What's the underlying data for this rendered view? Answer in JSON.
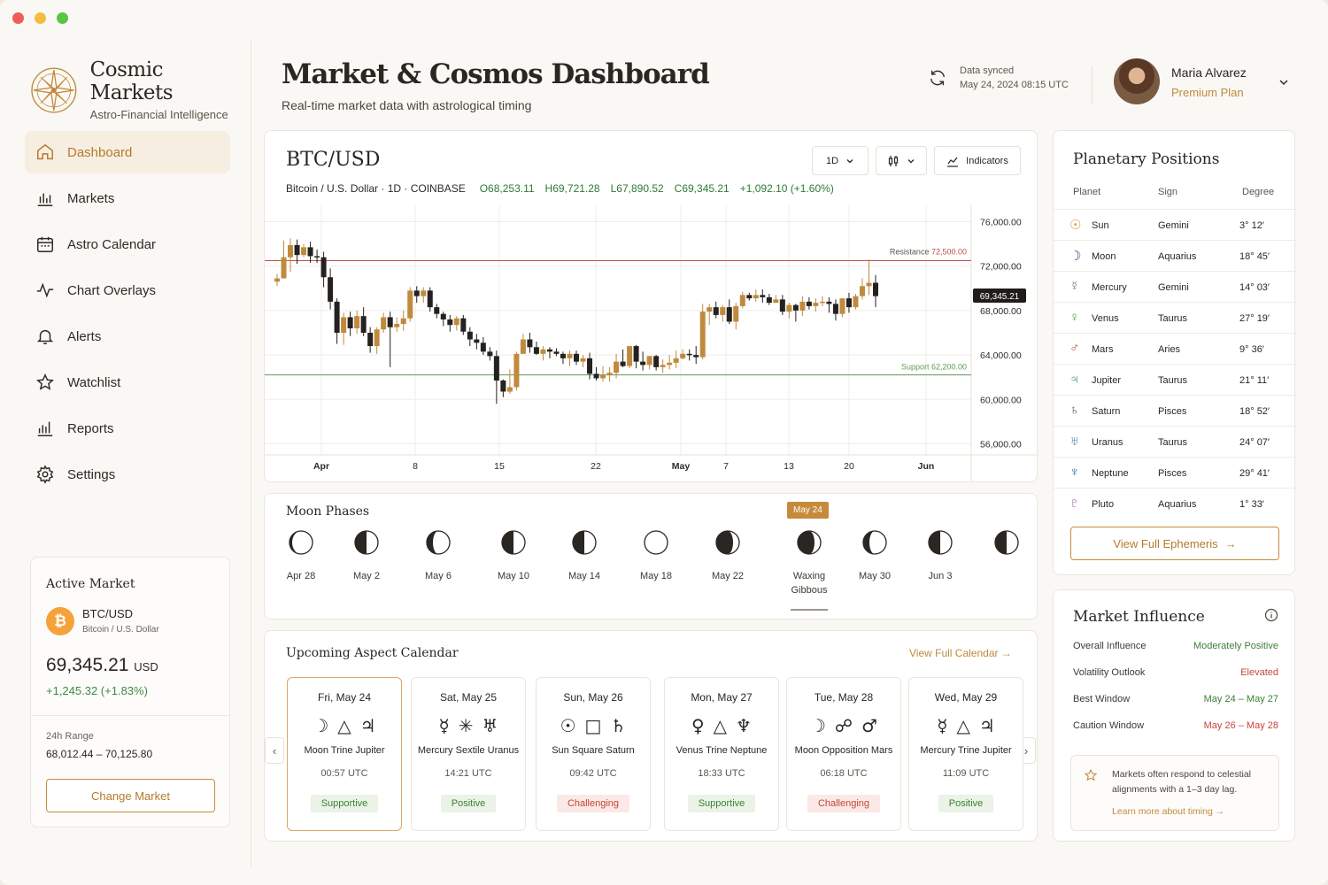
{
  "brand": {
    "title": "Cosmic Markets",
    "subtitle": "Astro-Financial Intelligence"
  },
  "nav": [
    {
      "label": "Dashboard",
      "icon": "home-icon",
      "active": true
    },
    {
      "label": "Markets",
      "icon": "bar-chart-icon"
    },
    {
      "label": "Astro Calendar",
      "icon": "calendar-icon"
    },
    {
      "label": "Chart Overlays",
      "icon": "activity-icon"
    },
    {
      "label": "Alerts",
      "icon": "bell-icon"
    },
    {
      "label": "Watchlist",
      "icon": "star-icon"
    },
    {
      "label": "Reports",
      "icon": "reports-icon"
    },
    {
      "label": "Settings",
      "icon": "gear-icon"
    }
  ],
  "active_market": {
    "title": "Active Market",
    "coin_symbol": "₿",
    "pair": "BTC/USD",
    "pair_name": "Bitcoin / U.S. Dollar",
    "price": "69,345.21",
    "currency": "USD",
    "change": "+1,245.32 (+1.83%)",
    "range_label": "24h Range",
    "range_value": "68,012.44 – 70,125.80",
    "button": "Change Market"
  },
  "header": {
    "title": "Market & Cosmos Dashboard",
    "subtitle": "Real-time market data with astrological timing",
    "sync_label": "Data synced",
    "sync_time": "May 24, 2024  08:15 UTC",
    "user_name": "Maria Alvarez",
    "user_plan": "Premium Plan"
  },
  "chart_panel": {
    "title": "BTC/USD",
    "subtitle": "Bitcoin / U.S. Dollar · 1D · COINBASE",
    "open": "O68,253.11",
    "high": "H69,721.28",
    "low": "L67,890.52",
    "close": "C69,345.21",
    "change": "+1,092.10 (+1.60%)",
    "interval": "1D",
    "indicators_label": "Indicators"
  },
  "chart_data": {
    "type": "candlestick",
    "y_ticks": [
      "76,000.00",
      "72,000.00",
      "68,000.00",
      "64,000.00",
      "60,000.00",
      "56,000.00"
    ],
    "ylim": [
      55000,
      77000
    ],
    "x_ticks": [
      "Apr",
      "8",
      "15",
      "22",
      "May",
      "7",
      "13",
      "20",
      "Jun"
    ],
    "current_price": "69,345.21",
    "resistance": {
      "label": "Resistance",
      "value": "72,500.00",
      "level": 72500
    },
    "support": {
      "label": "Support",
      "value": "62,200.00",
      "level": 62200
    },
    "candles": [
      [
        70600,
        70900,
        70200,
        71300
      ],
      [
        70900,
        72800,
        72500,
        74300
      ],
      [
        72800,
        73900,
        71500,
        74500
      ],
      [
        73900,
        73000,
        72200,
        74400
      ],
      [
        73000,
        73700,
        72800,
        74000
      ],
      [
        73700,
        72900,
        72300,
        74200
      ],
      [
        72900,
        72800,
        72300,
        73500
      ],
      [
        72800,
        71000,
        70100,
        73300
      ],
      [
        71000,
        68800,
        68100,
        71800
      ],
      [
        68800,
        66000,
        65000,
        69100
      ],
      [
        66000,
        67400,
        64900,
        67800
      ],
      [
        67400,
        66400,
        65700,
        67900
      ],
      [
        66400,
        67500,
        65900,
        68000
      ],
      [
        67500,
        66000,
        65700,
        68300
      ],
      [
        66000,
        64800,
        64200,
        66500
      ],
      [
        64800,
        66300,
        64100,
        66500
      ],
      [
        66300,
        67400,
        66000,
        67800
      ],
      [
        67400,
        66500,
        62900,
        67900
      ],
      [
        66500,
        66800,
        66100,
        67400
      ],
      [
        66800,
        67300,
        66200,
        68000
      ],
      [
        67300,
        69800,
        67000,
        70100
      ],
      [
        69800,
        69300,
        68700,
        70200
      ],
      [
        69300,
        69800,
        68700,
        70100
      ],
      [
        69800,
        68300,
        67900,
        70100
      ],
      [
        68300,
        67700,
        67300,
        68600
      ],
      [
        67700,
        67200,
        66600,
        67900
      ],
      [
        67200,
        66700,
        66100,
        67600
      ],
      [
        66700,
        67300,
        66200,
        67500
      ],
      [
        67300,
        66100,
        65800,
        67600
      ],
      [
        66100,
        65400,
        64800,
        66500
      ],
      [
        65400,
        65100,
        64500,
        65900
      ],
      [
        65100,
        64300,
        64000,
        65600
      ],
      [
        64300,
        63900,
        63500,
        64700
      ],
      [
        63900,
        61700,
        59600,
        64400
      ],
      [
        61700,
        60700,
        60200,
        61800
      ],
      [
        60700,
        61100,
        60500,
        62700
      ],
      [
        61100,
        64100,
        60800,
        64300
      ],
      [
        64100,
        65400,
        64100,
        65900
      ],
      [
        65400,
        64700,
        64200,
        66000
      ],
      [
        64700,
        64100,
        64000,
        65200
      ],
      [
        64100,
        64500,
        63500,
        64800
      ],
      [
        64500,
        64300,
        63700,
        64700
      ],
      [
        64300,
        64100,
        63900,
        64600
      ],
      [
        64100,
        63700,
        63200,
        64300
      ],
      [
        63700,
        64100,
        63000,
        64400
      ],
      [
        64100,
        63400,
        63100,
        64400
      ],
      [
        63400,
        63700,
        62900,
        64000
      ],
      [
        63700,
        62300,
        61800,
        64200
      ],
      [
        62300,
        61900,
        61700,
        62900
      ],
      [
        61900,
        62200,
        61600,
        63000
      ],
      [
        62200,
        62400,
        61600,
        62900
      ],
      [
        62400,
        63400,
        61900,
        64100
      ],
      [
        63400,
        63000,
        62900,
        64500
      ],
      [
        63000,
        64800,
        62800,
        64800
      ],
      [
        64800,
        63400,
        62800,
        64900
      ],
      [
        63400,
        63100,
        62600,
        64300
      ],
      [
        63100,
        63900,
        62700,
        63900
      ],
      [
        63900,
        62900,
        62600,
        64000
      ],
      [
        62900,
        63100,
        62400,
        63600
      ],
      [
        63100,
        63300,
        62700,
        64000
      ],
      [
        63300,
        63700,
        62800,
        64400
      ],
      [
        63700,
        64100,
        63600,
        64500
      ],
      [
        64100,
        64000,
        63500,
        64500
      ],
      [
        64000,
        63800,
        63200,
        64800
      ],
      [
        63800,
        67900,
        63600,
        68600
      ],
      [
        67900,
        68300,
        66700,
        68600
      ],
      [
        68300,
        67600,
        67300,
        68800
      ],
      [
        67600,
        68300,
        67000,
        68500
      ],
      [
        68300,
        67000,
        66800,
        69000
      ],
      [
        67000,
        68400,
        66300,
        68700
      ],
      [
        68400,
        69400,
        68200,
        69700
      ],
      [
        69400,
        69100,
        68900,
        69600
      ],
      [
        69100,
        69400,
        68800,
        69900
      ],
      [
        69400,
        69200,
        68700,
        69900
      ],
      [
        69200,
        68700,
        68500,
        69500
      ],
      [
        68700,
        69000,
        68700,
        69400
      ],
      [
        69000,
        67900,
        67600,
        69400
      ],
      [
        67900,
        68500,
        67300,
        68700
      ],
      [
        68500,
        68000,
        67000,
        68600
      ],
      [
        68000,
        68800,
        67500,
        69300
      ],
      [
        68800,
        68400,
        68100,
        69200
      ],
      [
        68400,
        68700,
        67900,
        69100
      ],
      [
        68700,
        68800,
        68400,
        69300
      ],
      [
        68800,
        68600,
        67800,
        69200
      ],
      [
        68600,
        67700,
        67100,
        69000
      ],
      [
        67700,
        69100,
        67400,
        69100
      ],
      [
        69100,
        68300,
        67800,
        69600
      ],
      [
        68300,
        69300,
        68100,
        69500
      ],
      [
        69300,
        70200,
        69000,
        70900
      ],
      [
        70200,
        70500,
        69400,
        72600
      ],
      [
        70500,
        69300,
        68300,
        71200
      ]
    ],
    "colors": {
      "up": "#c08a3e",
      "down": "#24211e",
      "resistance": "#c0504a",
      "support": "#5e9a52"
    }
  },
  "moon_phases": {
    "title": "Moon Phases",
    "badge": "May 24",
    "items": [
      {
        "label": "Apr 28",
        "phase": "waning-crescent"
      },
      {
        "label": "May 2",
        "phase": "last-quarter"
      },
      {
        "label": "May 6",
        "phase": "waning-gibbous"
      },
      {
        "label": "May 10",
        "phase": "last-quarter"
      },
      {
        "label": "May 14",
        "phase": "first-quarter"
      },
      {
        "label": "May 18",
        "phase": "full"
      },
      {
        "label": "May 22",
        "phase": "waxing-gibbous"
      },
      {
        "label": "Waxing Gibbous",
        "phase": "waxing-gibbous",
        "current": true
      },
      {
        "label": "May 30",
        "phase": "waning-gibbous"
      },
      {
        "label": "Jun 3",
        "phase": "last-quarter"
      },
      {
        "label": "",
        "phase": "last-quarter"
      }
    ]
  },
  "aspects": {
    "title": "Upcoming Aspect Calendar",
    "link": "View Full Calendar →",
    "cards": [
      {
        "day": "Fri, May 24",
        "symbols": "☽△♃",
        "name": "Moon Trine Jupiter",
        "time": "00:57 UTC",
        "tag": "Supportive",
        "tone": "sup",
        "selected": true
      },
      {
        "day": "Sat, May 25",
        "symbols": "☿✳♅",
        "name": "Mercury Sextile Uranus",
        "time": "14:21 UTC",
        "tag": "Positive",
        "tone": "sup"
      },
      {
        "day": "Sun, May 26",
        "symbols": "☉□♄",
        "name": "Sun Square Saturn",
        "time": "09:42 UTC",
        "tag": "Challenging",
        "tone": "chal"
      },
      {
        "day": "Mon, May 27",
        "symbols": "♀△♆",
        "name": "Venus Trine Neptune",
        "time": "18:33 UTC",
        "tag": "Supportive",
        "tone": "sup"
      },
      {
        "day": "Tue, May 28",
        "symbols": "☽☍♂",
        "name": "Moon Opposition Mars",
        "time": "06:18 UTC",
        "tag": "Challenging",
        "tone": "chal"
      },
      {
        "day": "Wed, May 29",
        "symbols": "☿△♃",
        "name": "Mercury Trine Jupiter",
        "time": "11:09 UTC",
        "tag": "Positive",
        "tone": "sup"
      }
    ]
  },
  "planets": {
    "title": "Planetary Positions",
    "headers": [
      "Planet",
      "Sign",
      "Degree"
    ],
    "rows": [
      {
        "glyph": "☉",
        "planet": "Sun",
        "sign": "Gemini",
        "degree": "3° 12′",
        "color": "#d69a2d"
      },
      {
        "glyph": "☽",
        "planet": "Moon",
        "sign": "Aquarius",
        "degree": "18° 45′",
        "color": "#4a4a6a"
      },
      {
        "glyph": "☿",
        "planet": "Mercury",
        "sign": "Gemini",
        "degree": "14° 03′",
        "color": "#5a7a8a"
      },
      {
        "glyph": "♀",
        "planet": "Venus",
        "sign": "Taurus",
        "degree": "27° 19′",
        "color": "#4f9a4a"
      },
      {
        "glyph": "♂",
        "planet": "Mars",
        "sign": "Aries",
        "degree": "9° 36′",
        "color": "#c4453a"
      },
      {
        "glyph": "♃",
        "planet": "Jupiter",
        "sign": "Taurus",
        "degree": "21° 11′",
        "color": "#3d8a5a"
      },
      {
        "glyph": "♄",
        "planet": "Saturn",
        "sign": "Pisces",
        "degree": "18° 52′",
        "color": "#5a4a3a"
      },
      {
        "glyph": "♅",
        "planet": "Uranus",
        "sign": "Taurus",
        "degree": "24° 07′",
        "color": "#4a7ab0"
      },
      {
        "glyph": "♆",
        "planet": "Neptune",
        "sign": "Pisces",
        "degree": "29° 41′",
        "color": "#3a6aa0"
      },
      {
        "glyph": "♇",
        "planet": "Pluto",
        "sign": "Aquarius",
        "degree": "1° 33′",
        "color": "#8a4a9a"
      }
    ],
    "button": "View Full Ephemeris"
  },
  "influence": {
    "title": "Market Influence",
    "rows": [
      {
        "label": "Overall Influence",
        "value": "Moderately Positive",
        "color": "#3d7f37"
      },
      {
        "label": "Volatility Outlook",
        "value": "Elevated",
        "color": "#c4453a"
      },
      {
        "label": "Best Window",
        "value": "May 24 – May 27",
        "color": "#3d7f37"
      },
      {
        "label": "Caution Window",
        "value": "May 26 – May 28",
        "color": "#c4453a"
      }
    ],
    "note": "Markets often respond to celestial alignments with a 1–3 day lag.",
    "note_link": "Learn more about timing →"
  },
  "colors": {
    "accent": "#c08a3e",
    "up": "#3d7f37",
    "down": "#c4453a",
    "bg": "#faf8f4"
  }
}
